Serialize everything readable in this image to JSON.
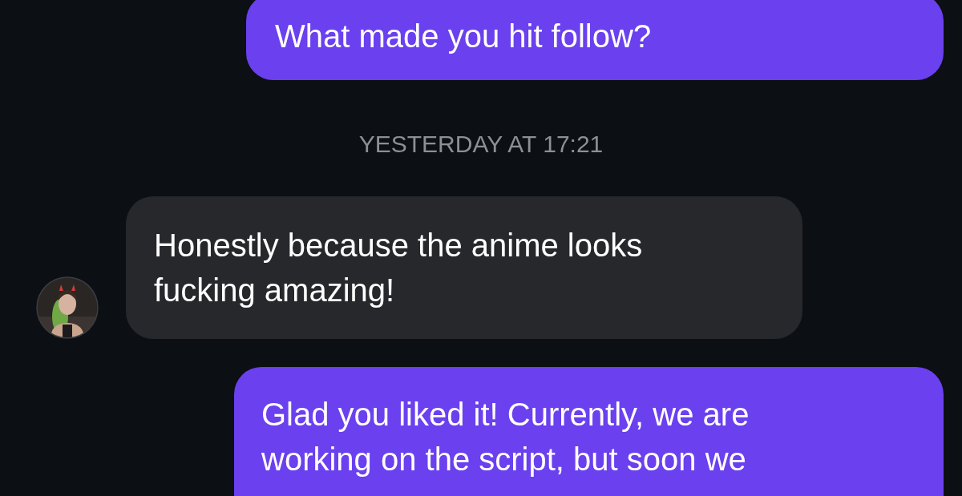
{
  "messages": [
    {
      "kind": "outgoing",
      "text": "What made you hit follow?"
    },
    {
      "kind": "timestamp",
      "text": "YESTERDAY AT 17:21"
    },
    {
      "kind": "incoming",
      "text": "Honestly because the anime looks fucking amazing!"
    },
    {
      "kind": "outgoing",
      "text": "Glad you liked it! Currently, we are working on the script, but soon we"
    }
  ]
}
